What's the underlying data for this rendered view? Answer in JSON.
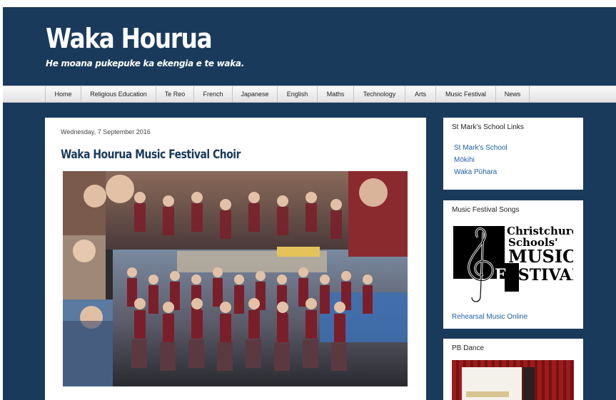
{
  "header": {
    "title": "Waka Hourua",
    "description": "He moana pukepuke ka ekengia e te waka."
  },
  "nav": {
    "items": [
      "Home",
      "Religious Education",
      "Te Reo",
      "French",
      "Japanese",
      "English",
      "Maths",
      "Technology",
      "Arts",
      "Music Festival",
      "News"
    ]
  },
  "post": {
    "date": "Wednesday, 7 September 2016",
    "title": "Waka Hourua Music Festival Choir",
    "bottom_text": ""
  },
  "sidebar": {
    "links_widget": {
      "title": "St Mark's School Links",
      "links": [
        "St Mark's School",
        "Mōkihi",
        "Waka Pūhara"
      ]
    },
    "festival_widget": {
      "title": "Music Festival Songs",
      "logo_text": "Christchurch Schools' MUSIC FESTIVAL",
      "link": "Rehearsal Music Online"
    },
    "dance_widget": {
      "title": "PB Dance"
    }
  },
  "colors": {
    "background": "#1a3a5c",
    "link": "#1f5fa8",
    "post_title": "#1a3a5c"
  }
}
